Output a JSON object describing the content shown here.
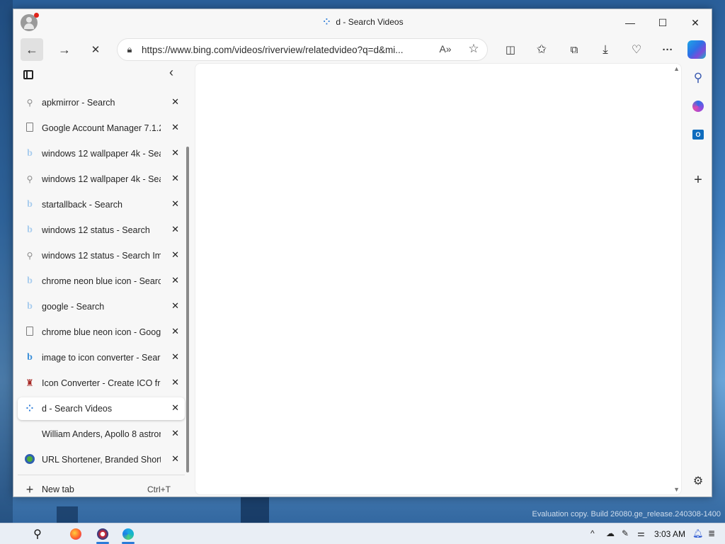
{
  "window": {
    "title": "d - Search Videos",
    "title_favicon": "loading-spinner-icon",
    "controls": {
      "minimize": "—",
      "maximize": "☐",
      "close": "✕"
    }
  },
  "toolbar": {
    "back": "←",
    "forward": "→",
    "stop": "✕",
    "url": "https://www.bing.com/videos/riverview/relatedvideo?q=d&mi...",
    "read_aloud": "A»",
    "favorite_star": "☆",
    "split_screen": "◫",
    "favorites": "✩",
    "collections": "⧉",
    "downloads": "⤓",
    "performance": "♡",
    "more": "···"
  },
  "tabs": [
    {
      "label": "apkmirror - Search",
      "icon": "search-icon",
      "glyph": "⚲"
    },
    {
      "label": "Google Account Manager 7.1.2 (",
      "icon": "document-icon",
      "glyph": ""
    },
    {
      "label": "windows 12 wallpaper 4k - Sear",
      "icon": "bing-icon",
      "glyph": "b"
    },
    {
      "label": "windows 12 wallpaper 4k - Sear",
      "icon": "search-icon",
      "glyph": "⚲"
    },
    {
      "label": "startallback - Search",
      "icon": "bing-icon",
      "glyph": "b"
    },
    {
      "label": "windows 12 status - Search",
      "icon": "bing-icon",
      "glyph": "b"
    },
    {
      "label": "windows 12 status - Search Imag",
      "icon": "search-icon",
      "glyph": "⚲"
    },
    {
      "label": "chrome neon blue icon - Search",
      "icon": "bing-icon",
      "glyph": "b"
    },
    {
      "label": "google - Search",
      "icon": "bing-icon",
      "glyph": "b"
    },
    {
      "label": "chrome blue neon icon - Google",
      "icon": "document-icon",
      "glyph": ""
    },
    {
      "label": "image to icon converter - Search",
      "icon": "bing-icon",
      "glyph": "b"
    },
    {
      "label": "Icon Converter - Create ICO from",
      "icon": "bottle-icon",
      "glyph": "♜"
    },
    {
      "label": "d - Search Videos",
      "icon": "loading-spinner-icon",
      "glyph": "⁘"
    },
    {
      "label": "William Anders, Apollo 8 astrona",
      "icon": "blank-icon",
      "glyph": ""
    },
    {
      "label": "URL Shortener, Branded Short Li",
      "icon": "url-shortener-icon",
      "glyph": ""
    }
  ],
  "tab_close": "✕",
  "pane": {
    "collapse": "‹"
  },
  "new_tab": {
    "label": "New tab",
    "shortcut": "Ctrl+T",
    "plus": "+"
  },
  "sidebar": {
    "plus": "+",
    "gear": "⚙",
    "search": "⚲"
  },
  "taskbar": {
    "search": "⚲",
    "clock": "3:03 AM"
  },
  "watermark": "Evaluation copy. Build 26080.ge_release.240308-1400"
}
